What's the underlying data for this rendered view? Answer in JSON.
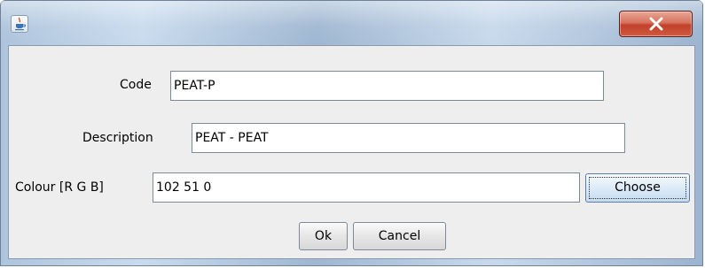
{
  "window": {
    "title": ""
  },
  "form": {
    "code": {
      "label": "Code",
      "value": "PEAT-P"
    },
    "description": {
      "label": "Description",
      "value": "PEAT - PEAT"
    },
    "colour": {
      "label": "Colour [R G B]",
      "value": "102 51 0",
      "choose_label": "Choose"
    }
  },
  "buttons": {
    "ok_label": "Ok",
    "cancel_label": "Cancel"
  },
  "icons": {
    "app": "java-cup-icon",
    "close": "close-icon"
  },
  "colors": {
    "close_button": "#c2402a",
    "dialog_background": "#eeeeee"
  }
}
